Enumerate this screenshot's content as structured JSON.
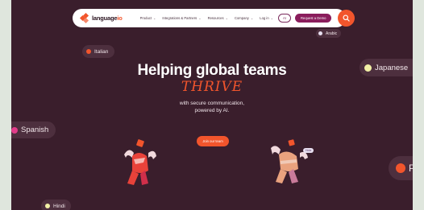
{
  "nav": {
    "logo_text_a": "language",
    "logo_text_b": "io",
    "menu": [
      {
        "label": "Product"
      },
      {
        "label": "Integrations & Partners"
      },
      {
        "label": "Resources"
      },
      {
        "label": "Company"
      },
      {
        "label": "Log in"
      }
    ],
    "ai_button": "AI",
    "demo_button": "Request a Demo",
    "search_icon": "search-icon"
  },
  "hero": {
    "title": "Helping global teams",
    "accent": "THRIVE",
    "subtitle_line1": "with secure communication,",
    "subtitle_line2": "powered by AI.",
    "cta": "Join our team"
  },
  "languages": {
    "arabic": "Arabic",
    "italian": "Italian",
    "japanese": "Japanese",
    "spanish": "Spanish",
    "hindi": "Hindi",
    "partial": "P"
  },
  "figure_tag": "Hola",
  "colors": {
    "background": "#3a1e2c",
    "accent": "#f2552c",
    "brand_purple": "#8a1d5c"
  }
}
